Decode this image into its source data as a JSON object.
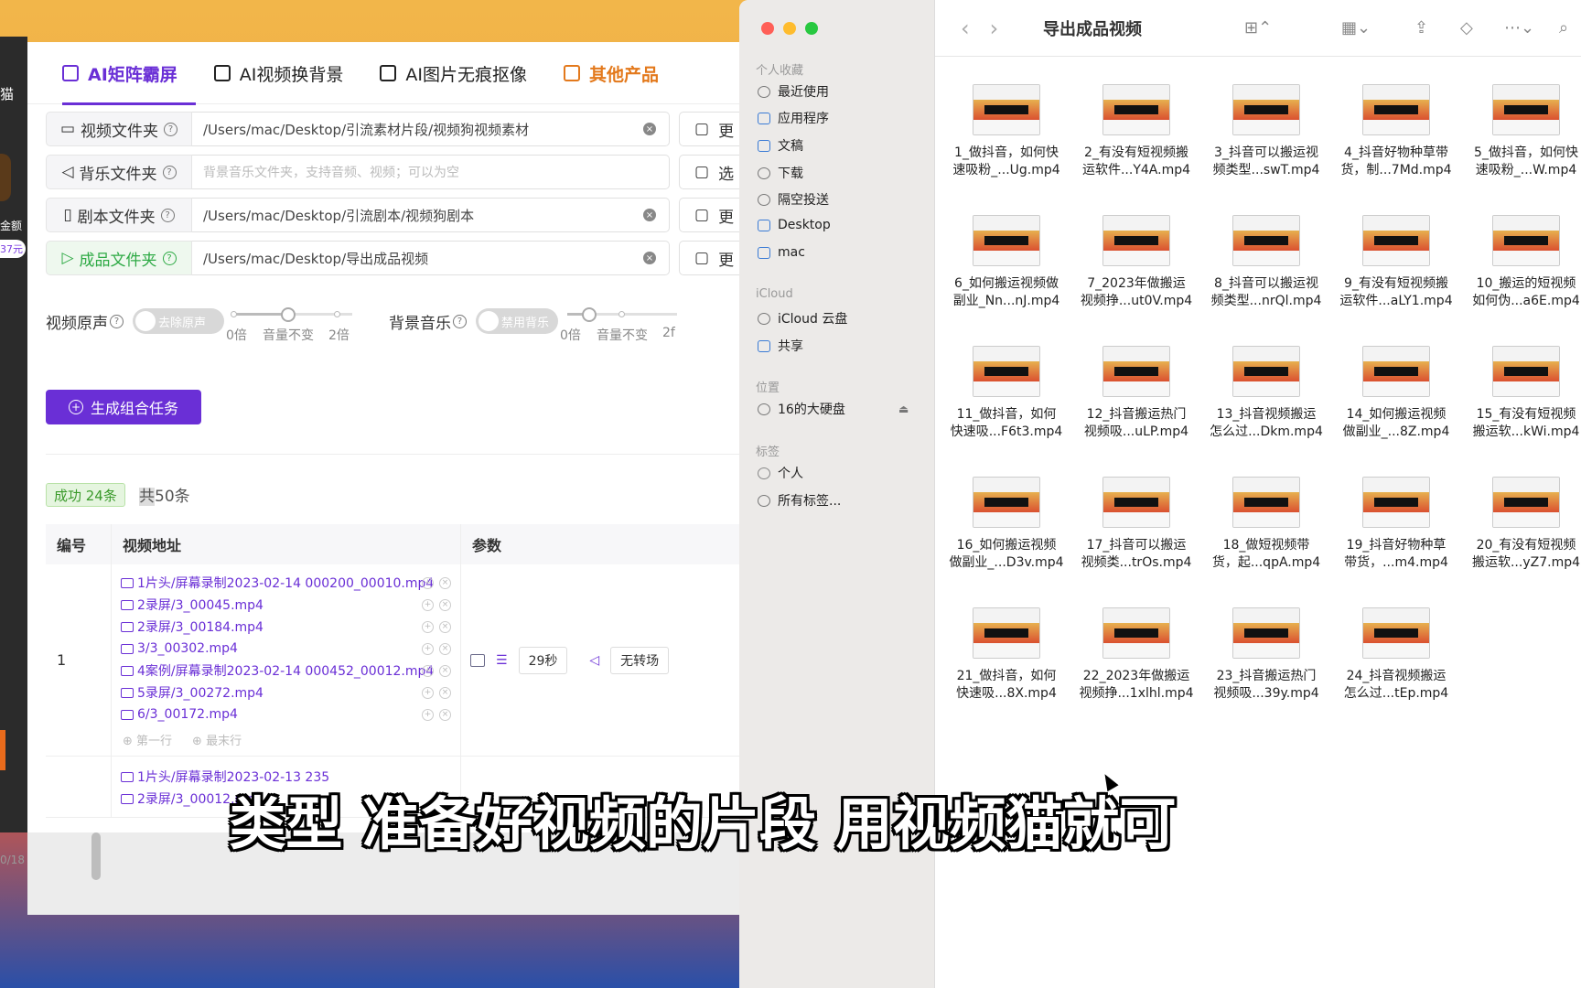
{
  "desktop": {
    "strip_texts": [
      "猫",
      "金额",
      "37元",
      "0/18"
    ]
  },
  "app": {
    "tabs": [
      {
        "label": "AI矩阵霸屏",
        "active": true
      },
      {
        "label": "AI视频换背景",
        "active": false
      },
      {
        "label": "AI图片无痕抠像",
        "active": false
      },
      {
        "label": "其他产品",
        "active": false,
        "color": "#e3791c"
      }
    ],
    "fields": [
      {
        "label": "视频文件夹",
        "value": "/Users/mac/Desktop/引流素材片段/视频狗视频素材",
        "side": "更"
      },
      {
        "label": "背乐文件夹",
        "placeholder": "背景音乐文件夹，支持音频、视频；可以为空",
        "side": "选"
      },
      {
        "label": "剧本文件夹",
        "value": "/Users/mac/Desktop/引流剧本/视频狗剧本",
        "side": "更"
      },
      {
        "label": "成品文件夹",
        "value": "/Users/mac/Desktop/导出成品视频",
        "side": "更"
      }
    ],
    "audio": {
      "video_label": "视频原声",
      "video_toggle": "去除原声",
      "bg_label": "背景音乐",
      "bg_toggle": "禁用背乐",
      "tick_0": "0倍",
      "tick_1": "音量不变",
      "tick_2": "2倍",
      "tick_2_cut": "2f",
      "video_level": 0.5,
      "bg_level": 0.1
    },
    "generate_button": "生成组合任务",
    "success": "成功 24条",
    "total_prefix": "共",
    "total_rest": "50条",
    "table": {
      "headers": [
        "编号",
        "视频地址",
        "参数"
      ],
      "rows": [
        {
          "id": "1",
          "files": [
            "1片头/屏幕录制2023-02-14 000200_00010.mp4",
            "2录屏/3_00045.mp4",
            "2录屏/3_00184.mp4",
            "3/3_00302.mp4",
            "4案例/屏幕录制2023-02-14 000452_00012.mp4",
            "5录屏/3_00272.mp4",
            "6/3_00172.mp4"
          ],
          "first_row": "第一行",
          "last_row": "最末行",
          "duration": "29秒",
          "transition": "无转场"
        },
        {
          "id": "",
          "files": [
            "1片头/屏幕录制2023-02-13 235",
            "2录屏/3_00012.mp4"
          ]
        }
      ]
    }
  },
  "finder": {
    "title": "导出成品视频",
    "sidebar": {
      "favorites_title": "个人收藏",
      "favorites": [
        "最近使用",
        "应用程序",
        "文稿",
        "下载",
        "隔空投送",
        "Desktop",
        "mac"
      ],
      "icloud_title": "iCloud",
      "icloud": [
        "iCloud 云盘",
        "共享"
      ],
      "locations_title": "位置",
      "locations": [
        "16的大硬盘"
      ],
      "tags_title": "标签",
      "tags": [
        "个人",
        "所有标签..."
      ]
    },
    "files": [
      [
        "1_做抖音，如何快",
        "速吸粉_...Ug.mp4"
      ],
      [
        "2_有没有短视频搬",
        "运软件...Y4A.mp4"
      ],
      [
        "3_抖音可以搬运视",
        "频类型...swT.mp4"
      ],
      [
        "4_抖音好物种草带",
        "货，制...7Md.mp4"
      ],
      [
        "5_做抖音，如何快",
        "速吸粉_...W.mp4"
      ],
      [
        "6_如何搬运视频做",
        "副业_Nn...nJ.mp4"
      ],
      [
        "7_2023年做搬运",
        "视频挣...ut0V.mp4"
      ],
      [
        "8_抖音可以搬运视",
        "频类型...nrQl.mp4"
      ],
      [
        "9_有没有短视频搬",
        "运软件...aLY1.mp4"
      ],
      [
        "10_搬运的短视频",
        "如何伪...a6E.mp4"
      ],
      [
        "11_做抖音，如何",
        "快速吸...F6t3.mp4"
      ],
      [
        "12_抖音搬运热门",
        "视频吸...uLP.mp4"
      ],
      [
        "13_抖音视频搬运",
        "怎么过...Dkm.mp4"
      ],
      [
        "14_如何搬运视频",
        "做副业_...8Z.mp4"
      ],
      [
        "15_有没有短视频",
        "搬运软...kWi.mp4"
      ],
      [
        "16_如何搬运视频",
        "做副业_...D3v.mp4"
      ],
      [
        "17_抖音可以搬运",
        "视频类...trOs.mp4"
      ],
      [
        "18_做短视频带",
        "货，起...qpA.mp4"
      ],
      [
        "19_抖音好物种草",
        "带货，...m4.mp4"
      ],
      [
        "20_有没有短视频",
        "搬运软...yZ7.mp4"
      ],
      [
        "21_做抖音，如何",
        "快速吸...8X.mp4"
      ],
      [
        "22_2023年做搬运",
        "视频挣...1xlhl.mp4"
      ],
      [
        "23_抖音搬运热门",
        "视频吸...39y.mp4"
      ],
      [
        "24_抖音视频搬运",
        "怎么过...tEp.mp4"
      ]
    ]
  },
  "subtitle": "类型 准备好视频的片段 用视频猫就可"
}
